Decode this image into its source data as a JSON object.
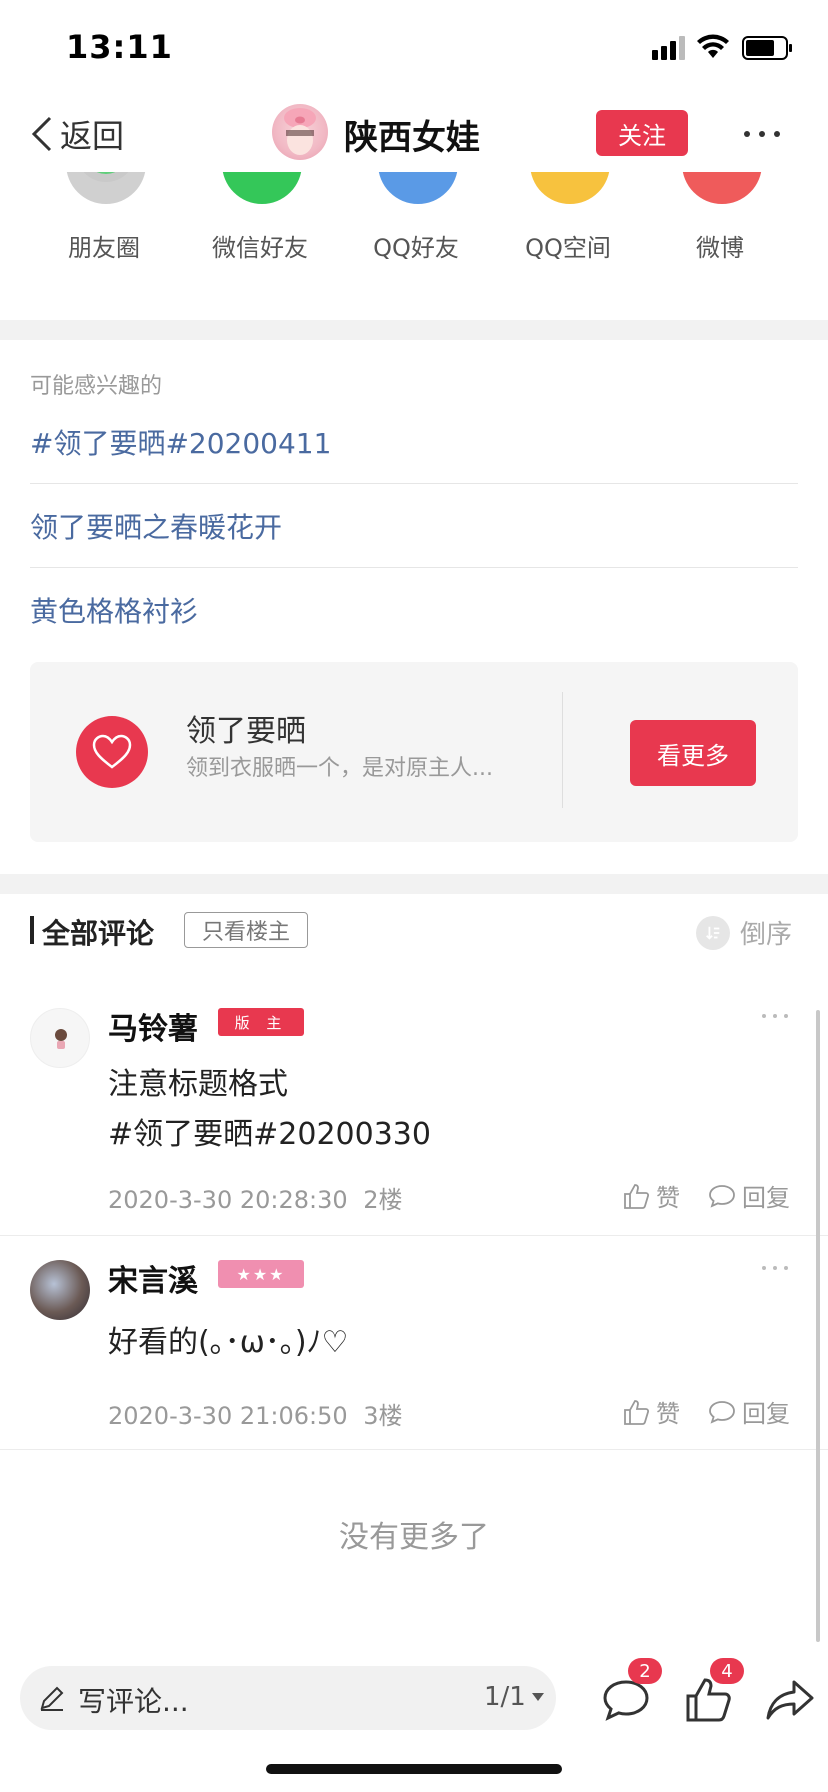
{
  "status_bar": {
    "time": "13:11"
  },
  "nav": {
    "back_label": "返回",
    "title": "陕西女娃",
    "follow_label": "关注"
  },
  "share": {
    "items": [
      {
        "label": "朋友圈",
        "color": "#b9b9b9",
        "icon": "moments-icon"
      },
      {
        "label": "微信好友",
        "color": "#34c759",
        "icon": "wechat-icon"
      },
      {
        "label": "QQ好友",
        "color": "#5a9ae6",
        "icon": "qq-icon"
      },
      {
        "label": "QQ空间",
        "color": "#f7c23e",
        "icon": "qzone-icon"
      },
      {
        "label": "微博",
        "color": "#ef5b5b",
        "icon": "weibo-icon"
      }
    ]
  },
  "interests": {
    "heading": "可能感兴趣的",
    "topics": [
      "#领了要晒#20200411",
      "领了要晒之春暖花开",
      "黄色格格衬衫"
    ]
  },
  "card": {
    "title": "领了要晒",
    "desc": "领到衣服晒一个，是对原主人...",
    "button": "看更多"
  },
  "comments_header": {
    "title": "全部评论",
    "only_op": "只看楼主",
    "order": "倒序"
  },
  "comments": [
    {
      "user": "马铃薯",
      "badge": "版 主",
      "badge_color": "#e8384f",
      "lines": [
        "注意标题格式",
        "#领了要晒#20200330"
      ],
      "time": "2020-3-30 20:28:30",
      "floor": "2楼",
      "like": "赞",
      "reply": "回复"
    },
    {
      "user": "宋言溪",
      "badge": "★★★",
      "badge_color": "#f08fb0",
      "lines": [
        "好看的(｡･ω･｡)ﾉ♡"
      ],
      "time": "2020-3-30 21:06:50",
      "floor": "3楼",
      "like": "赞",
      "reply": "回复"
    }
  ],
  "no_more": "没有更多了",
  "bottom_bar": {
    "placeholder": "写评论...",
    "page": "1/1",
    "comment_count": "2",
    "like_count": "4"
  },
  "accent": "#e8384f"
}
